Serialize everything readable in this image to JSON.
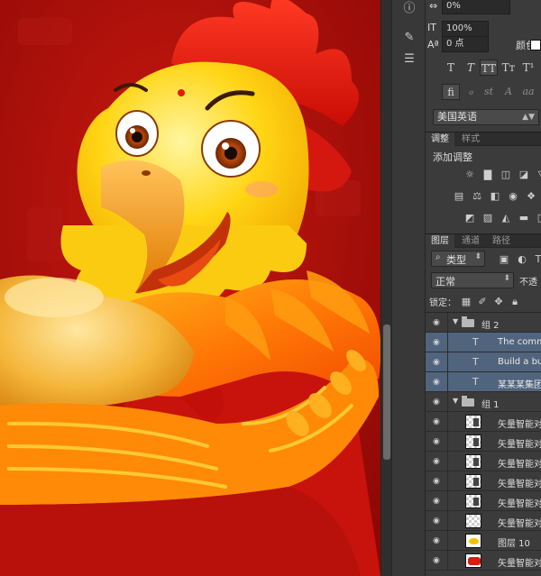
{
  "character_panel": {
    "tracking_value": "0%",
    "scale_value": "100%",
    "baseline_value": "0 点",
    "color_label": "颜色",
    "typo_buttons": [
      "T",
      "T",
      "TT",
      "Tт",
      "T¹"
    ],
    "ligature_buttons": [
      "fi",
      "ℴ",
      "st",
      "A",
      "aa"
    ],
    "language": "美国英语"
  },
  "adjustments_panel": {
    "tabs": [
      "调整",
      "样式"
    ],
    "add_label": "添加调整"
  },
  "layers_panel": {
    "tabs": [
      "图层",
      "通道",
      "路径"
    ],
    "filter_label": "类型",
    "blend_mode": "正常",
    "opacity_label": "不透",
    "lock_label": "锁定：",
    "layers": [
      {
        "name": "组 2",
        "type": "group"
      },
      {
        "name": "The commu",
        "type": "text",
        "selected": true
      },
      {
        "name": "Build a bul",
        "type": "text",
        "selected": true
      },
      {
        "name": "某某某集团",
        "type": "text",
        "selected": true
      },
      {
        "name": "组 1",
        "type": "group"
      },
      {
        "name": "矢量智能对",
        "type": "smart"
      },
      {
        "name": "矢量智能对",
        "type": "smart"
      },
      {
        "name": "矢量智能对",
        "type": "smart"
      },
      {
        "name": "矢量智能对",
        "type": "smart"
      },
      {
        "name": "矢量智能对",
        "type": "smart"
      },
      {
        "name": "矢量智能对",
        "type": "smart"
      },
      {
        "name": "图层 10",
        "type": "pixel"
      },
      {
        "name": "矢量智能对",
        "type": "smart"
      }
    ]
  },
  "colors": {
    "canvas_bg": "#a90f0b",
    "selection": "#51647e",
    "panel_bg": "#3b3b3b"
  }
}
